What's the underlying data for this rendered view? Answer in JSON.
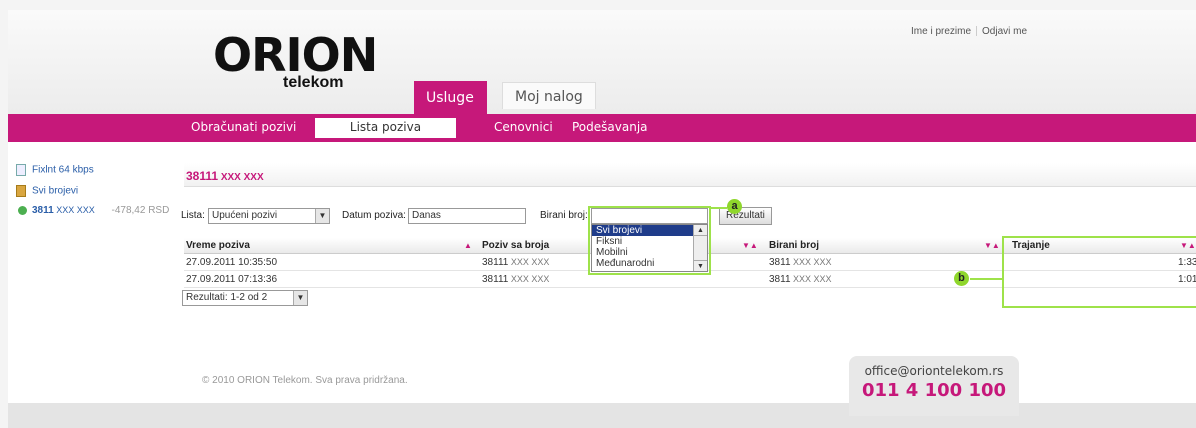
{
  "brand": {
    "logo_word": "ORION",
    "logo_sub": "telekom",
    "accent": "#c6187a"
  },
  "user": {
    "name": "Ime i prezime",
    "logout": "Odjavi me"
  },
  "tabs": [
    {
      "label": "Usluge"
    },
    {
      "label": "Moj nalog"
    }
  ],
  "nav": [
    {
      "label": "Obračunati pozivi"
    },
    {
      "label": "Lista poziva"
    },
    {
      "label": "Cenovnici"
    },
    {
      "label": "Podešavanja"
    }
  ],
  "sidebar": {
    "plan": "Fixlnt 64 kbps",
    "all_numbers": "Svi brojevi",
    "number": {
      "prefix": "3811",
      "masked": " XXX XXX",
      "balance": "-478,42 RSD"
    }
  },
  "content": {
    "title_prefix": "38111",
    "title_masked": " XXX XXX",
    "filters": {
      "lista_label": "Lista:",
      "lista_value": "Upućeni pozivi",
      "datum_label": "Datum poziva:",
      "datum_value": "Danas",
      "birani_label": "Birani broj:",
      "birani_value": "",
      "button": "Rezultati"
    },
    "dropdown_options": [
      "Svi brojevi",
      "Fiksni",
      "Mobilni",
      "Međunarodni"
    ],
    "columns": [
      "Vreme poziva",
      "Poziv sa broja",
      "Birani broj",
      "Trajanje"
    ],
    "rows": [
      {
        "time": "27.09.2011 10:35:50",
        "from_prefix": "38111",
        "from_masked": " XXX XXX",
        "to_prefix": "3811",
        "to_masked": " XXX XXX",
        "duration": "1:33"
      },
      {
        "time": "27.09.2011 07:13:36",
        "from_prefix": "38111",
        "from_masked": " XXX XXX",
        "to_prefix": "3811",
        "to_masked": " XXX XXX",
        "duration": "1:01"
      }
    ],
    "results": "Rezultati: 1-2 od 2"
  },
  "markers": {
    "a": "a",
    "b": "b"
  },
  "footer": {
    "copyright": "© 2010 ORION Telekom. Sva prava pridržana.",
    "email": "office@oriontelekom.rs",
    "phone": "011 4 100 100"
  },
  "icons": {
    "arrow": "▼",
    "sort": "▼▲",
    "sort_up": "▲",
    "scroll_up": "▲"
  }
}
